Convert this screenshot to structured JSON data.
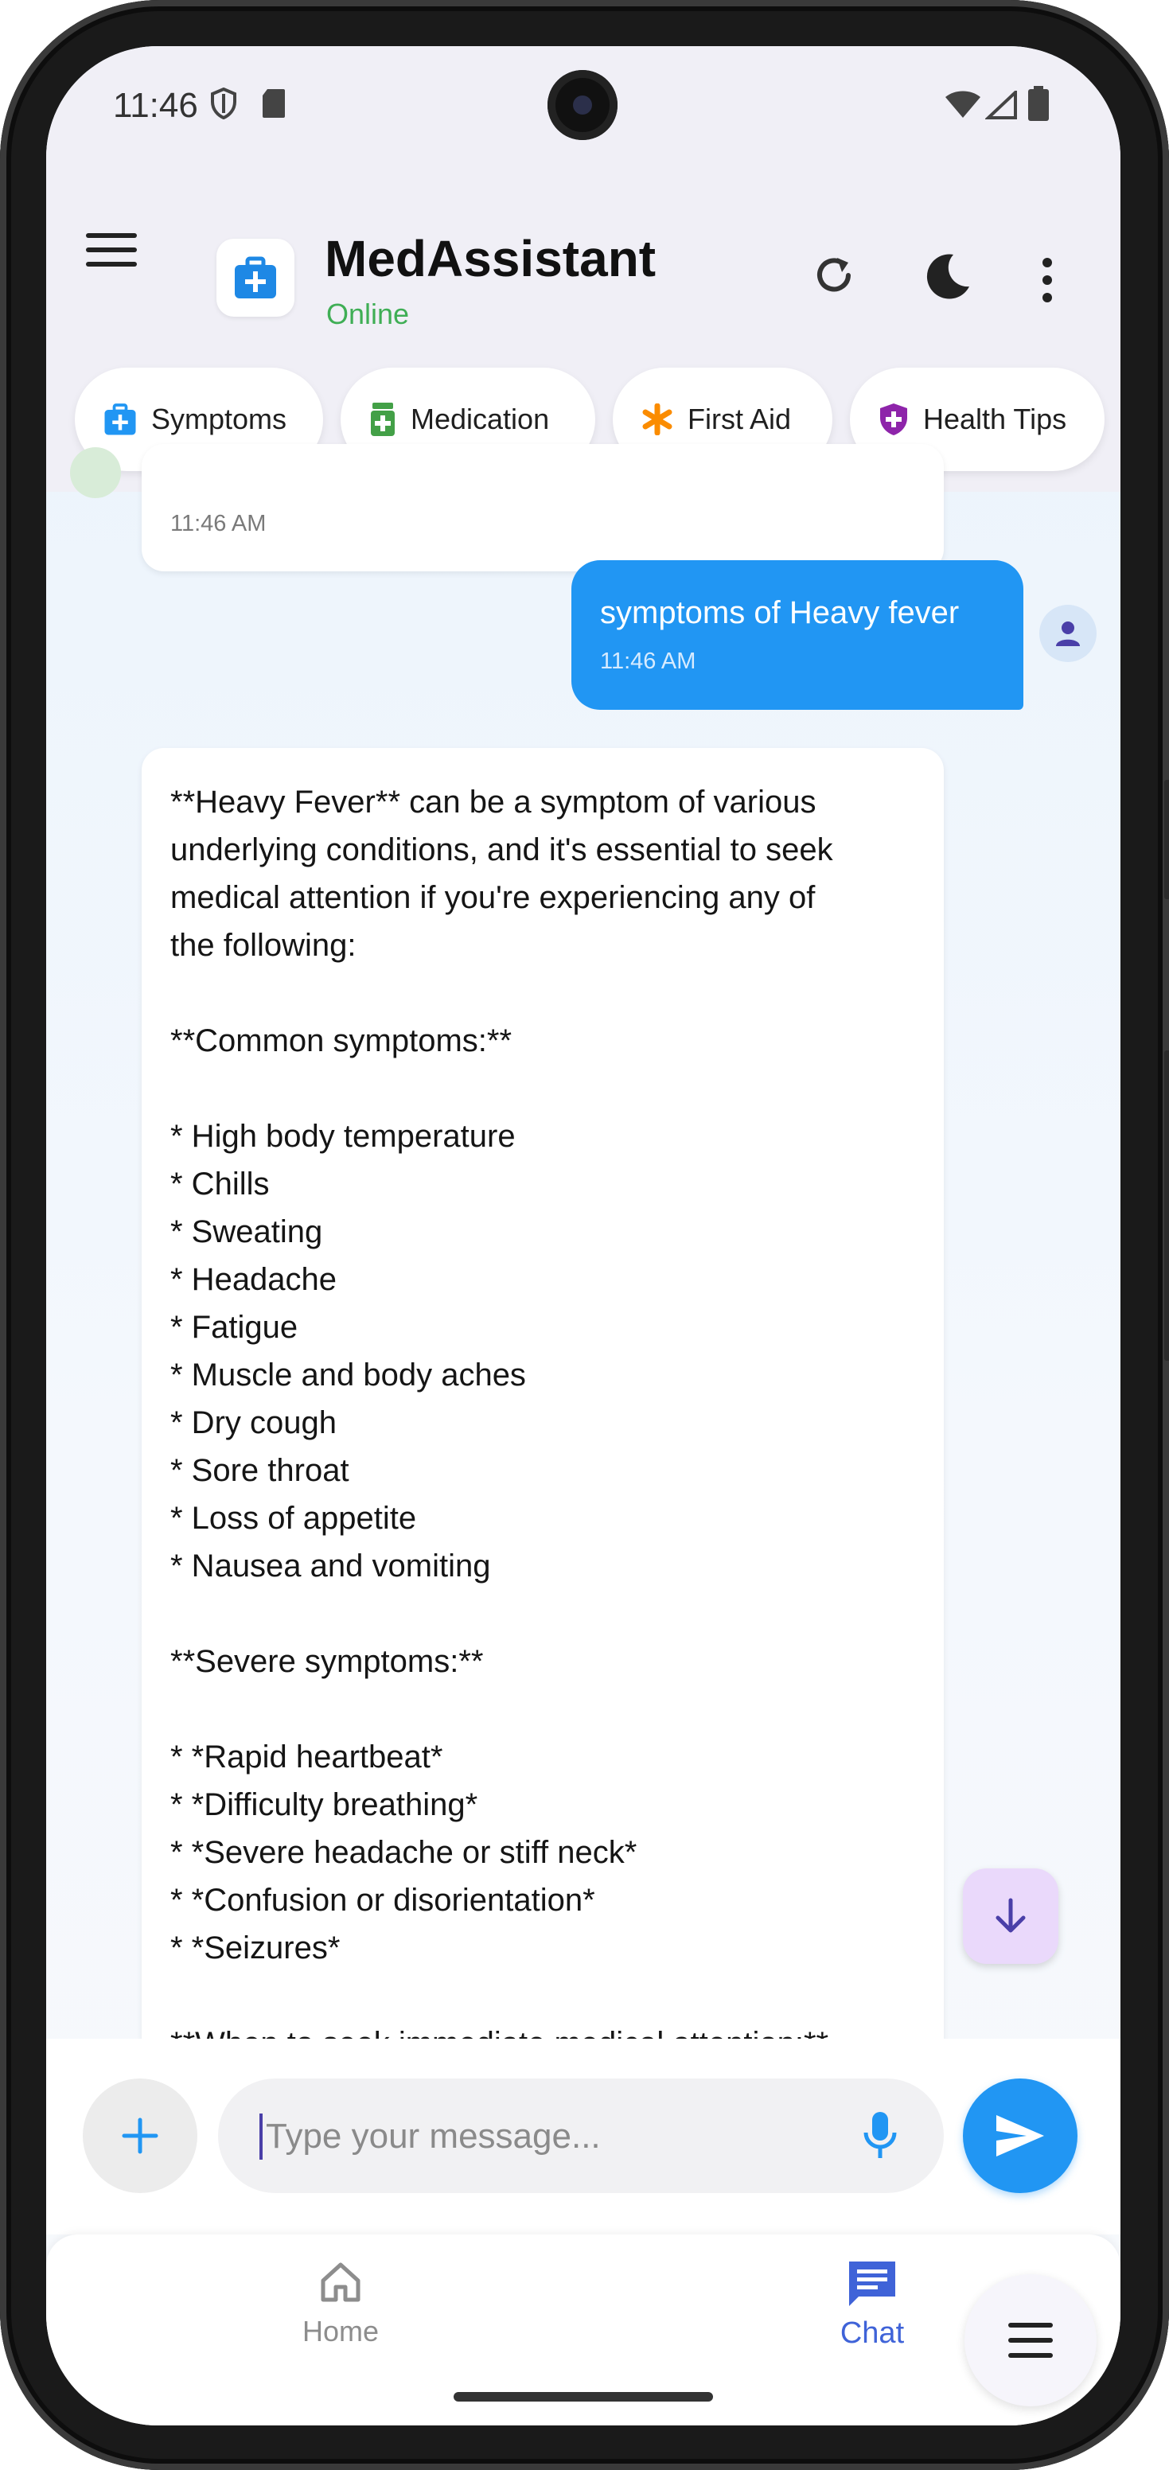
{
  "status_bar": {
    "time": "11:46"
  },
  "app_bar": {
    "title": "MedAssistant",
    "status": "Online"
  },
  "chips": [
    {
      "label": "Symptoms",
      "icon": "medical-kit-icon",
      "color": "#2196f3"
    },
    {
      "label": "Medication",
      "icon": "pill-bottle-icon",
      "color": "#43a047"
    },
    {
      "label": "First Aid",
      "icon": "asterisk-icon",
      "color": "#fb8c00"
    },
    {
      "label": "Health Tips",
      "icon": "shield-plus-icon",
      "color": "#8e24aa"
    }
  ],
  "messages": {
    "previous_bot_time": "11:46 AM",
    "user_message": {
      "text": "symptoms of Heavy fever",
      "time": "11:46 AM"
    },
    "bot_reply_lines": [
      "**Heavy Fever** can be a symptom of various",
      "underlying conditions, and it's essential to seek",
      "medical attention if you're experiencing any of",
      "the following:",
      "",
      "**Common symptoms:**",
      "",
      "* High body temperature",
      "* Chills",
      "* Sweating",
      "* Headache",
      "* Fatigue",
      "* Muscle and body aches",
      "* Dry cough",
      "* Sore throat",
      "* Loss of appetite",
      "* Nausea and vomiting",
      "",
      "**Severe symptoms:**",
      "",
      "* *Rapid heartbeat*",
      "* *Difficulty breathing*",
      "* *Severe headache or stiff neck*",
      "* *Confusion or disorientation*",
      "* *Seizures*",
      "",
      "**When to seek immediate medical attention:**"
    ]
  },
  "input": {
    "placeholder": "Type your message..."
  },
  "bottom_nav": {
    "home_label": "Home",
    "chat_label": "Chat",
    "active": "Chat"
  },
  "colors": {
    "accent": "#2196f3",
    "online": "#3fae55",
    "nav_active": "#3f63d8"
  }
}
